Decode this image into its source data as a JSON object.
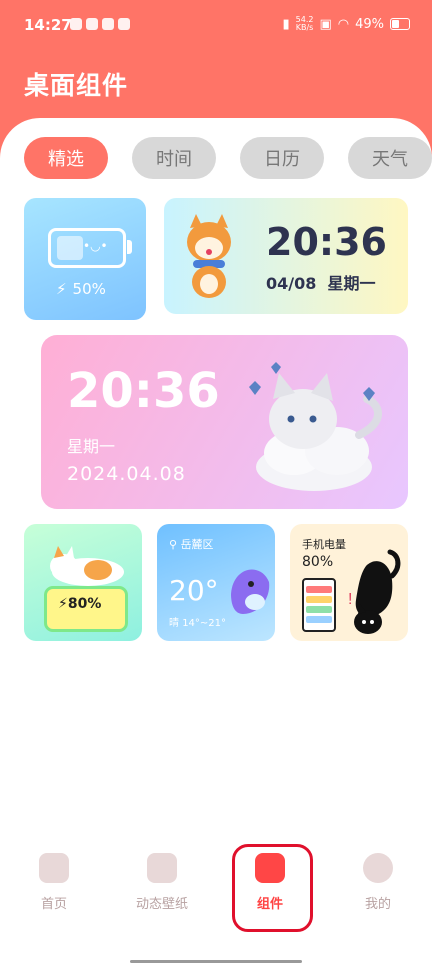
{
  "status": {
    "time": "14:27",
    "net_top": "54.2",
    "net_bottom": "KB/s",
    "battery": "49%"
  },
  "header": {
    "title": "桌面组件"
  },
  "tabs": [
    {
      "label": "精选",
      "active": true
    },
    {
      "label": "时间"
    },
    {
      "label": "日历"
    },
    {
      "label": "天气"
    }
  ],
  "widgets": {
    "battery_blue": {
      "percent": "50%"
    },
    "dog_clock": {
      "time": "20:36",
      "date": "04/08",
      "weekday": "星期一"
    },
    "pink_clock": {
      "time": "20:36",
      "weekday": "星期一",
      "date": "2024.04.08"
    },
    "cat_battery": {
      "percent": "80%"
    },
    "weather": {
      "location": "岳麓区",
      "temperature": "20°",
      "condition": "晴",
      "range": "14°~21°"
    },
    "phone_battery": {
      "label": "手机电量",
      "percent": "80%"
    }
  },
  "bottom_nav": [
    {
      "label": "首页"
    },
    {
      "label": "动态壁纸"
    },
    {
      "label": "组件",
      "active": true
    },
    {
      "label": "我的"
    }
  ]
}
